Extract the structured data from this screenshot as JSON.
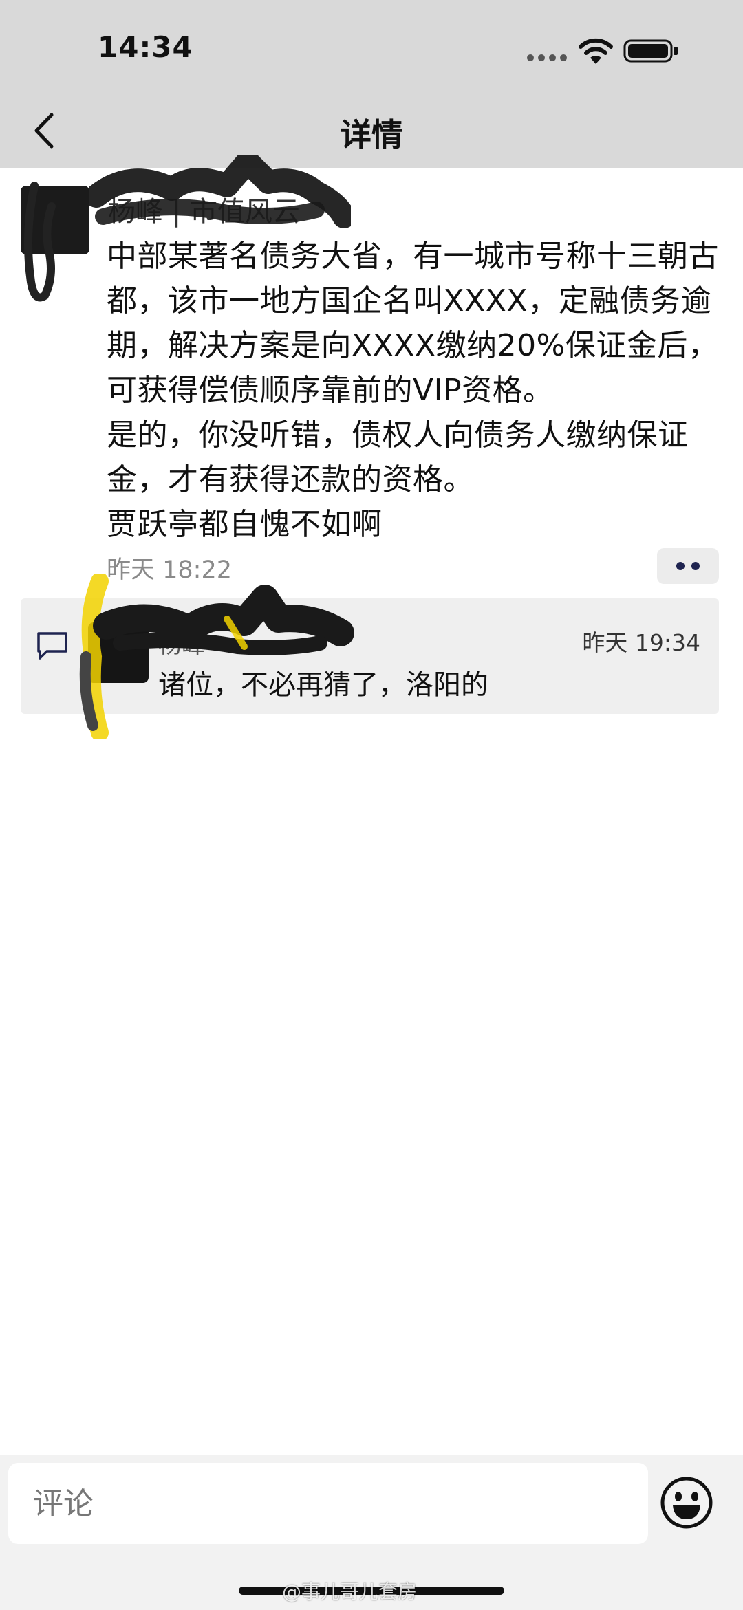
{
  "status_bar": {
    "time": "14:34"
  },
  "header": {
    "title": "详情"
  },
  "post": {
    "author_name": "杨峰 | 市值风云",
    "content": [
      "中部某著名债务大省，有一城市号称十三朝古都，该市一地方国企名叫XXXX，定融债务逾期，解决方案是向XXXX缴纳20%保证金后，可获得偿债顺序靠前的VIP资格。",
      "是的，你没听错，债权人向债务人缴纳保证金，才有获得还款的资格。",
      "贾跃亭都自愧不如啊"
    ],
    "time": "昨天 18:22"
  },
  "comment": {
    "author_name": "杨峰",
    "time": "昨天 19:34",
    "text": "诸位，不必再猜了，洛阳的"
  },
  "bottom": {
    "input_placeholder": "评论",
    "watermark": "@事儿哥儿套房"
  },
  "colors": {
    "header_bg": "#d9d9d9",
    "comment_box_bg": "#efefef",
    "accent_dots": "#1f2450",
    "highlight_yellow": "#f2d200"
  },
  "icons": [
    "back-icon",
    "signal-icon",
    "wifi-icon",
    "battery-icon",
    "more-icon",
    "comment-icon",
    "emoji-icon"
  ]
}
